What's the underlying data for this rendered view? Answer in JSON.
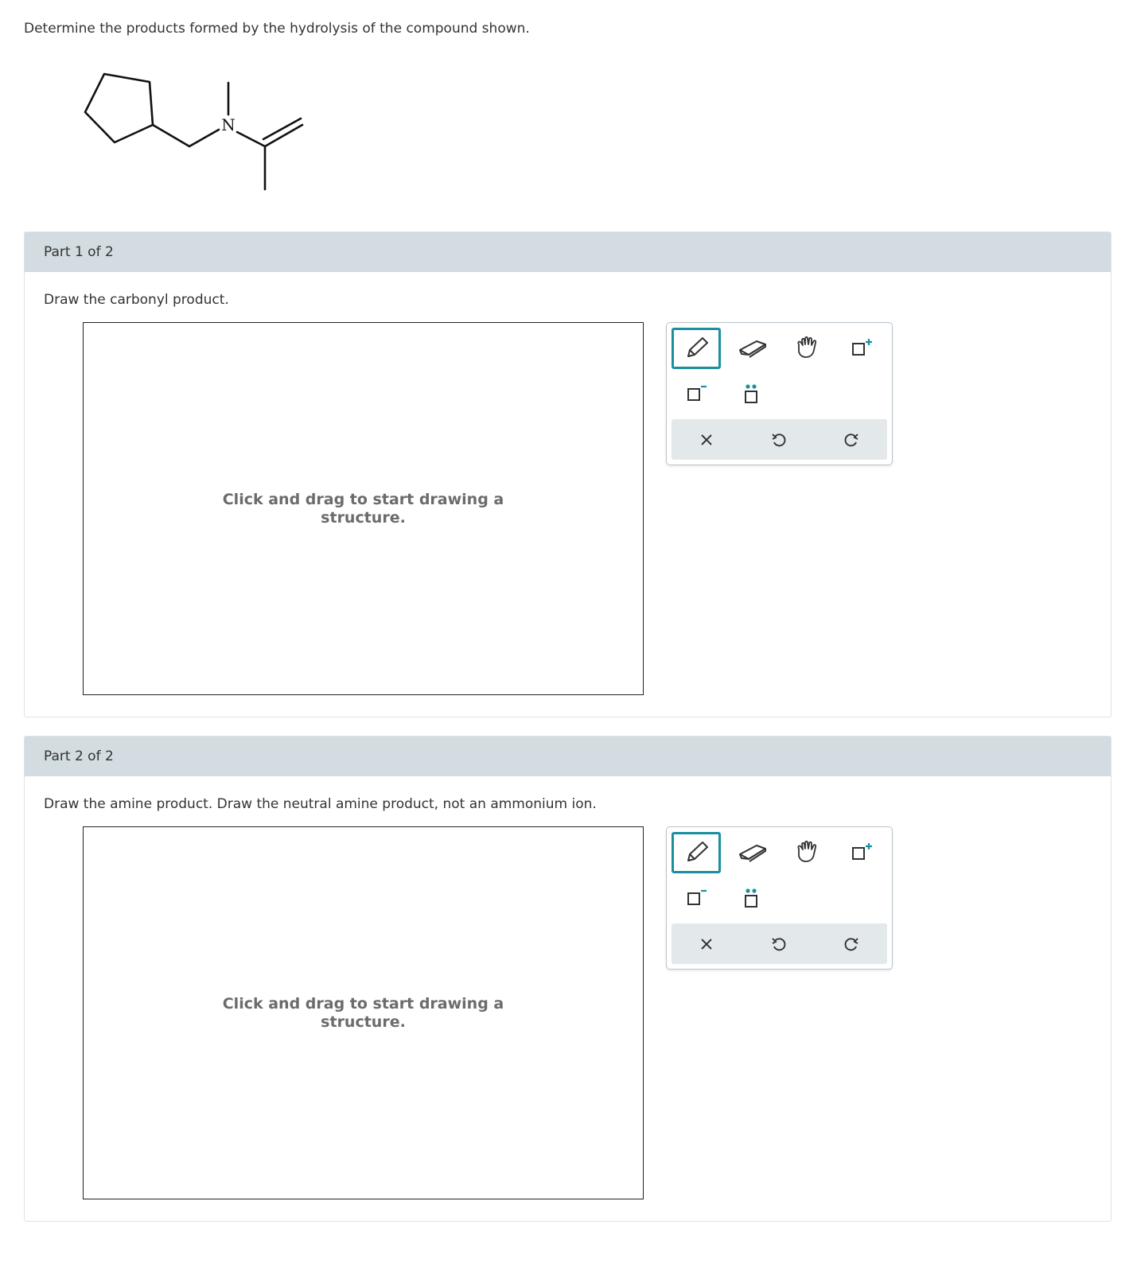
{
  "question": "Determine the products formed by the hydrolysis of the compound shown.",
  "molecule": {
    "atom_labels": [
      "N"
    ]
  },
  "parts": [
    {
      "header": "Part 1 of 2",
      "prompt": "Draw the carbonyl product.",
      "canvas_hint": "Click and drag to start drawing a structure."
    },
    {
      "header": "Part 2 of 2",
      "prompt": "Draw the amine product. Draw the neutral amine product, not an ammonium ion.",
      "canvas_hint": "Click and drag to start drawing a structure."
    }
  ],
  "toolbar": {
    "tools": [
      "pencil-icon",
      "eraser-icon",
      "hand-icon",
      "add-positive-charge-icon",
      "add-negative-charge-icon",
      "add-lone-pair-icon"
    ],
    "actions": [
      "clear-icon",
      "undo-icon",
      "redo-icon"
    ],
    "active_tool": "pencil-icon",
    "colors": {
      "accent": "#1a8fa0",
      "header_bg": "#d3dce0",
      "action_bg": "#e3e8eb"
    }
  }
}
